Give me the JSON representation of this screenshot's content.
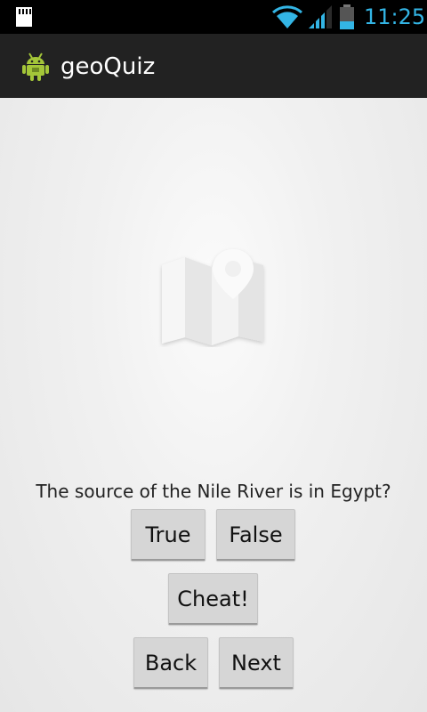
{
  "status_bar": {
    "time": "11:25",
    "accent_color": "#33b5e5",
    "icons": [
      "sd-card-icon",
      "wifi-icon",
      "signal-icon",
      "battery-icon"
    ]
  },
  "action_bar": {
    "title": "geoQuiz",
    "icon": "android-robot-icon"
  },
  "quiz": {
    "image_icon": "map-pin-icon",
    "question": "The source of the Nile River is in Egypt?",
    "true_label": "True",
    "false_label": "False",
    "cheat_label": "Cheat!",
    "back_label": "Back",
    "next_label": "Next"
  }
}
